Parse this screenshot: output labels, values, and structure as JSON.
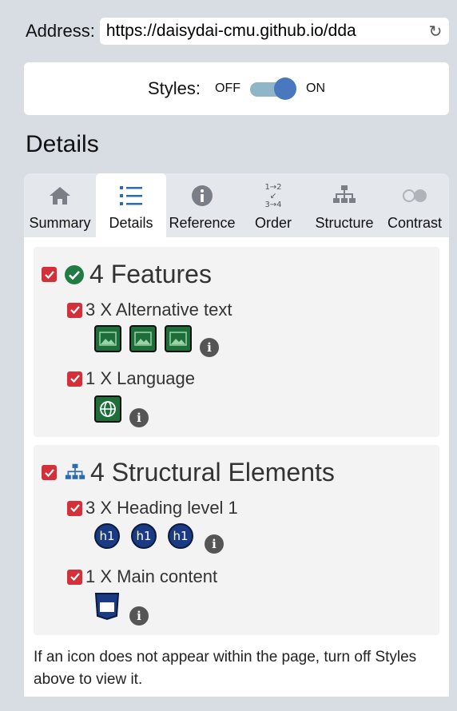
{
  "address": {
    "label": "Address:",
    "url": "https://daisydai-cmu.github.io/dda"
  },
  "styles": {
    "label": "Styles:",
    "off": "OFF",
    "on": "ON"
  },
  "section_title": "Details",
  "tabs": [
    {
      "label": "Summary",
      "icon": "home-icon"
    },
    {
      "label": "Details",
      "icon": "list-icon",
      "active": true
    },
    {
      "label": "Reference",
      "icon": "info-icon"
    },
    {
      "label": "Order",
      "icon": "order-icon",
      "order_glyph": "1→2 ↙ 3→4"
    },
    {
      "label": "Structure",
      "icon": "sitemap-icon"
    },
    {
      "label": "Contrast",
      "icon": "contrast-icon"
    }
  ],
  "features": {
    "title": "4 Features",
    "items": [
      {
        "label": "3 X Alternative text"
      },
      {
        "label": "1 X Language"
      }
    ]
  },
  "structural": {
    "title": "4 Structural Elements",
    "items": [
      {
        "label": "3 X Heading level 1",
        "badge": "h1"
      },
      {
        "label": "1 X Main content"
      }
    ]
  },
  "footer_note": "If an icon does not appear within the page, turn off Styles above to view it.",
  "colors": {
    "checkbox": "#d3303a",
    "green": "#1e6e3a",
    "heading_blue": "#1a3b84",
    "toggle_knob": "#4a78be"
  }
}
